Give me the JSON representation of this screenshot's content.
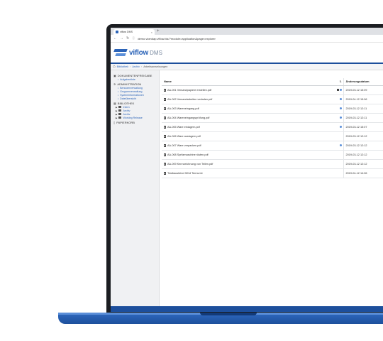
{
  "browser": {
    "tab_title": "viflow DMS",
    "tab_close": "×",
    "new_tab": "+",
    "url": "demo.viomdap.viflow.biz/?module=application&page=explorer"
  },
  "app": {
    "logo_name": "viflow",
    "logo_sub": "DMS"
  },
  "breadcrumb": [
    "Bibliothek",
    "Archiv",
    "Arbeitsanweisungen"
  ],
  "sidebar": {
    "sections": [
      {
        "label": "DOKUMENTENFREIGABE",
        "icon": "inbox-icon",
        "items": [
          {
            "label": "Aufgabenliste"
          }
        ]
      },
      {
        "label": "ADMINISTRATION",
        "icon": "gear-icon",
        "items": [
          {
            "label": "Benutzerverwaltung"
          },
          {
            "label": "Gruppenverwaltung"
          },
          {
            "label": "Systeminformationen"
          },
          {
            "label": "Dateiübersicht"
          }
        ]
      },
      {
        "label": "BIBLIOTHEK",
        "icon": "library-icon",
        "tree": [
          {
            "label": "Intern"
          },
          {
            "label": "Archiv"
          },
          {
            "label": "Archiv"
          },
          {
            "label": "Working Release"
          }
        ]
      },
      {
        "label": "PAPIERKORB",
        "icon": "trash-icon"
      }
    ]
  },
  "table": {
    "headers": {
      "name": "Name",
      "status": "",
      "date": "Änderungsdatum"
    },
    "rows": [
      {
        "name": "AA-001 Versandpapiere erstellen.pdf",
        "date": "2019-03-12 15:09",
        "locked": true,
        "status": true
      },
      {
        "name": "AA-002 Versandarbeiten verladen.pdf",
        "date": "2019-04-12 15:06",
        "locked": false,
        "status": true
      },
      {
        "name": "AA-003 Wareneingang.pdf",
        "date": "2019-03-12 12:11",
        "locked": false,
        "status": true
      },
      {
        "name": "AA-004 Wareneingangsprüfung.pdf",
        "date": "2019-03-12 12:11",
        "locked": false,
        "status": true
      },
      {
        "name": "AA-005 Ware einlagern.pdf",
        "date": "2019-03-12 15:07",
        "locked": false,
        "status": true
      },
      {
        "name": "AA-006 Ware auslagern.pdf",
        "date": "2019-03-12 12:12",
        "locked": false,
        "status": false
      },
      {
        "name": "AA-007 Ware verpacken.pdf",
        "date": "2019-03-12 12:12",
        "locked": false,
        "status": true
      },
      {
        "name": "AA-008 Spritzmaschine rüsten.pdf",
        "date": "2019-03-12 12:12",
        "locked": false,
        "status": false
      },
      {
        "name": "AA-009 Kennzeichnung von Teilen.pdf",
        "date": "2019-03-12 12:12",
        "locked": false,
        "status": false
      },
      {
        "name": "Testbausteine DIN4 Terms.txt",
        "date": "2019-04-12 14:06",
        "locked": false,
        "status": false
      }
    ]
  },
  "colors": {
    "accent": "#2c64b8",
    "laptop_base": "#1d4f9c",
    "bezel": "#1b1d21"
  }
}
